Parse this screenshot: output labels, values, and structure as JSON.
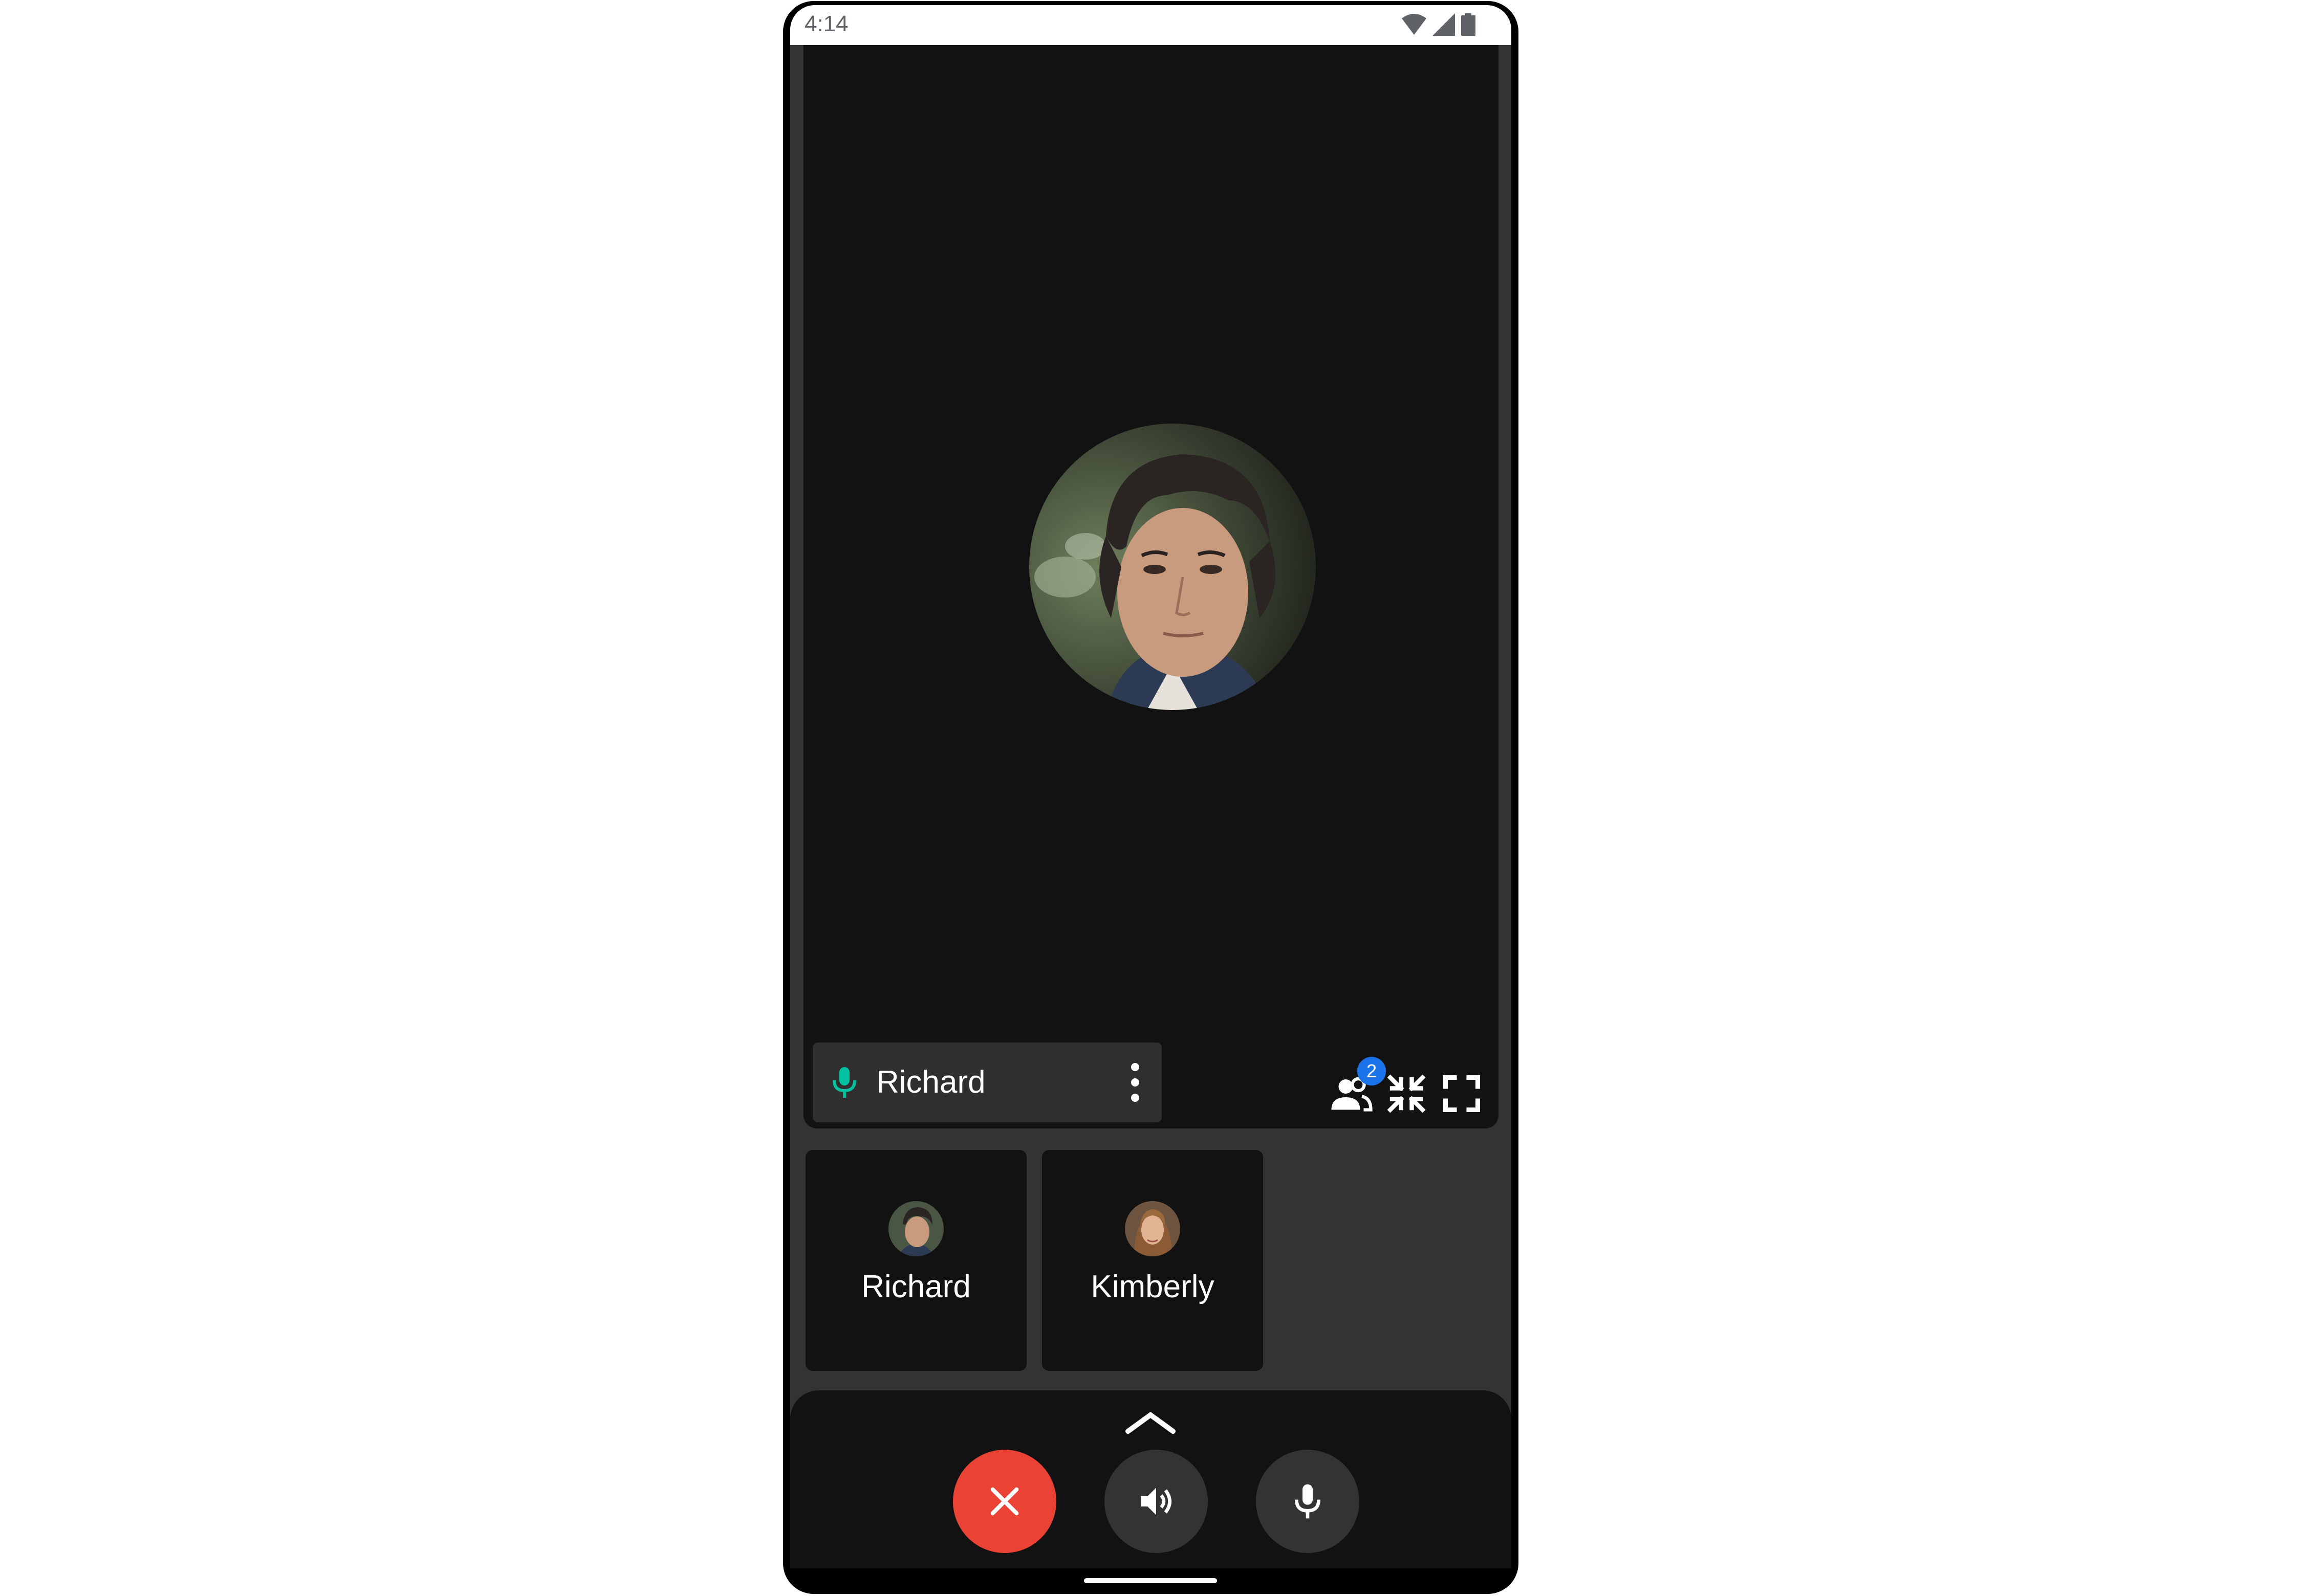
{
  "status_bar": {
    "time": "4:14",
    "icons": [
      "wifi-icon",
      "cell-signal-icon",
      "battery-icon"
    ]
  },
  "main_tile": {
    "participant_name": "Richard",
    "avatar": "richard-avatar",
    "mic_state": "on",
    "mic_color": "#00c1a0",
    "controls": {
      "participants_count": "2",
      "participants_icon": "participants-icon",
      "minimize_icon": "exit-fullscreen-icon",
      "fullscreen_icon": "fullscreen-icon"
    }
  },
  "thumbnails": [
    {
      "name": "Richard",
      "avatar": "richard-avatar"
    },
    {
      "name": "Kimberly",
      "avatar": "kimberly-avatar"
    }
  ],
  "call_controls": {
    "expand_icon": "chevron-up-icon",
    "end_call_icon": "close-icon",
    "end_call_color": "#ea4335",
    "speaker_icon": "speaker-icon",
    "mic_icon": "mic-icon"
  }
}
